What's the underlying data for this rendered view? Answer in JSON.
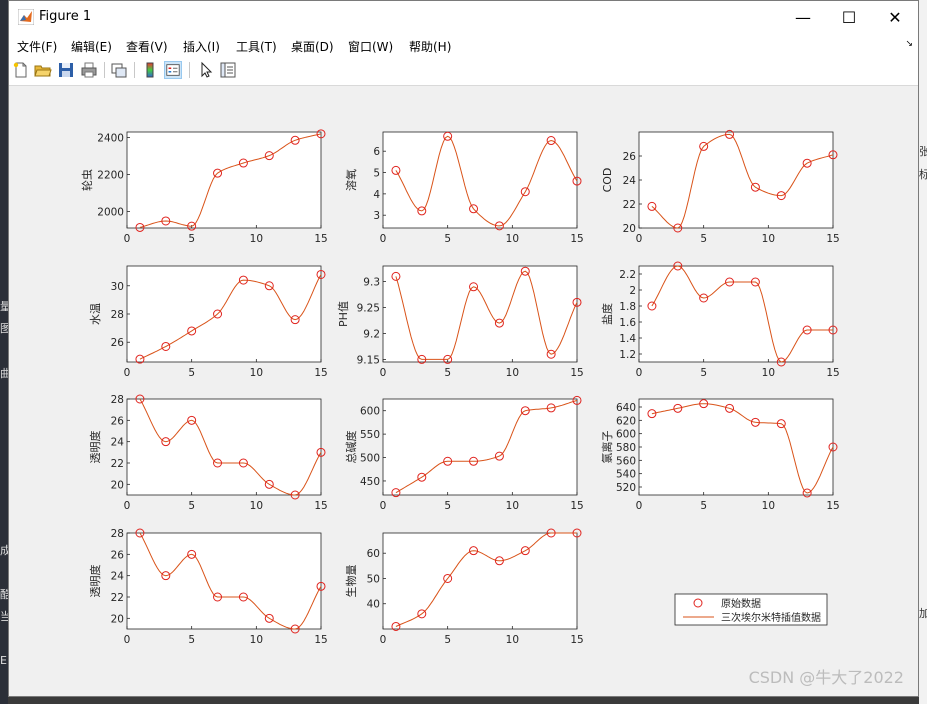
{
  "window": {
    "title": "Figure 1",
    "minimize": "—",
    "maximize": "☐",
    "close": "✕"
  },
  "menu": [
    "文件(F)",
    "编辑(E)",
    "查看(V)",
    "插入(I)",
    "工具(T)",
    "桌面(D)",
    "窗口(W)",
    "帮助(H)"
  ],
  "toolbar": [
    "new-figure",
    "open-file",
    "save",
    "print",
    "link-plot",
    "colorbar",
    "legend",
    "edit-plot",
    "property-inspector"
  ],
  "colors": {
    "original": "#e0231e",
    "interp": "#d95319",
    "bg": "#f0f0f0"
  },
  "legend": {
    "original": "原始数据",
    "interp": "三次埃尔米特插值数据"
  },
  "watermark": "CSDN @牛大了2022",
  "background": {
    "right": [
      "张",
      "标",
      "加"
    ],
    "left": [
      "量",
      "图",
      "曲",
      "成",
      "酷",
      "当",
      "E"
    ]
  },
  "chart_data": [
    {
      "type": "line",
      "ylabel": "轮虫",
      "xlim": [
        0,
        15
      ],
      "ylim": [
        1910,
        2430
      ],
      "xticks": [
        0,
        5,
        10,
        15
      ],
      "yticks": [
        2000,
        2200,
        2400
      ],
      "x": [
        1,
        3,
        5,
        7,
        9,
        11,
        13,
        15
      ],
      "y": [
        1913,
        1948,
        1920,
        2207,
        2262,
        2302,
        2385,
        2420
      ]
    },
    {
      "type": "line",
      "ylabel": "溶氧",
      "xlim": [
        0,
        15
      ],
      "ylim": [
        2.4,
        6.9
      ],
      "xticks": [
        0,
        5,
        10,
        15
      ],
      "yticks": [
        3,
        4,
        5,
        6
      ],
      "x": [
        1,
        3,
        5,
        7,
        9,
        11,
        13,
        15
      ],
      "y": [
        5.1,
        3.2,
        6.7,
        3.3,
        2.5,
        4.1,
        6.5,
        4.6
      ]
    },
    {
      "type": "line",
      "ylabel": "COD",
      "xlim": [
        0,
        15
      ],
      "ylim": [
        20,
        28
      ],
      "xticks": [
        0,
        5,
        10,
        15
      ],
      "yticks": [
        20,
        22,
        24,
        26
      ],
      "x": [
        1,
        3,
        5,
        7,
        9,
        11,
        13,
        15
      ],
      "y": [
        21.8,
        20,
        26.8,
        27.8,
        23.4,
        22.7,
        25.4,
        26.1
      ]
    },
    {
      "type": "line",
      "ylabel": "水温",
      "xlim": [
        0,
        15
      ],
      "ylim": [
        24.6,
        31.4
      ],
      "xticks": [
        0,
        5,
        10,
        15
      ],
      "yticks": [
        26,
        28,
        30
      ],
      "x": [
        1,
        3,
        5,
        7,
        9,
        11,
        13,
        15
      ],
      "y": [
        24.8,
        25.7,
        26.8,
        28,
        30.4,
        30,
        27.6,
        30.8
      ]
    },
    {
      "type": "line",
      "ylabel": "PH值",
      "xlim": [
        0,
        15
      ],
      "ylim": [
        9.145,
        9.33
      ],
      "xticks": [
        0,
        5,
        10,
        15
      ],
      "yticks": [
        9.15,
        9.2,
        9.25,
        9.3
      ],
      "x": [
        1,
        3,
        5,
        7,
        9,
        11,
        13,
        15
      ],
      "y": [
        9.31,
        9.15,
        9.15,
        9.29,
        9.22,
        9.32,
        9.16,
        9.26
      ]
    },
    {
      "type": "line",
      "ylabel": "盐度",
      "xlim": [
        0,
        15
      ],
      "ylim": [
        1.1,
        2.3
      ],
      "xticks": [
        0,
        5,
        10,
        15
      ],
      "yticks": [
        1.2,
        1.4,
        1.6,
        1.8,
        2,
        2.2
      ],
      "x": [
        1,
        3,
        5,
        7,
        9,
        11,
        13,
        15
      ],
      "y": [
        1.8,
        2.3,
        1.9,
        2.1,
        2.1,
        1.1,
        1.5,
        1.5
      ]
    },
    {
      "type": "line",
      "ylabel": "透明度",
      "xlim": [
        0,
        15
      ],
      "ylim": [
        19,
        28
      ],
      "xticks": [
        0,
        5,
        10,
        15
      ],
      "yticks": [
        20,
        22,
        24,
        26,
        28
      ],
      "x": [
        1,
        3,
        5,
        7,
        9,
        11,
        13,
        15
      ],
      "y": [
        28,
        24,
        26,
        22,
        22,
        20,
        19,
        23
      ]
    },
    {
      "type": "line",
      "ylabel": "总碱度",
      "xlim": [
        0,
        15
      ],
      "ylim": [
        420,
        625
      ],
      "xticks": [
        0,
        5,
        10,
        15
      ],
      "yticks": [
        450,
        500,
        550,
        600
      ],
      "x": [
        1,
        3,
        5,
        7,
        9,
        11,
        13,
        15
      ],
      "y": [
        425,
        458,
        492,
        492,
        503,
        600,
        606,
        622
      ]
    },
    {
      "type": "line",
      "ylabel": "氯离子",
      "xlim": [
        0,
        15
      ],
      "ylim": [
        508,
        652
      ],
      "xticks": [
        0,
        5,
        10,
        15
      ],
      "yticks": [
        520,
        540,
        560,
        580,
        600,
        620,
        640
      ],
      "x": [
        1,
        3,
        5,
        7,
        9,
        11,
        13,
        15
      ],
      "y": [
        630,
        638,
        645,
        638,
        617,
        615,
        511,
        580
      ]
    },
    {
      "type": "line",
      "ylabel": "透明度",
      "xlim": [
        0,
        15
      ],
      "ylim": [
        19,
        28
      ],
      "xticks": [
        0,
        5,
        10,
        15
      ],
      "yticks": [
        20,
        22,
        24,
        26,
        28
      ],
      "x": [
        1,
        3,
        5,
        7,
        9,
        11,
        13,
        15
      ],
      "y": [
        28,
        24,
        26,
        22,
        22,
        20,
        19,
        23
      ]
    },
    {
      "type": "line",
      "ylabel": "生物量",
      "xlim": [
        0,
        15
      ],
      "ylim": [
        30,
        68
      ],
      "xticks": [
        0,
        5,
        10,
        15
      ],
      "yticks": [
        40,
        50,
        60
      ],
      "x": [
        1,
        3,
        5,
        7,
        9,
        11,
        13,
        15
      ],
      "y": [
        31,
        36,
        50,
        61,
        57,
        61,
        68,
        68
      ]
    }
  ]
}
